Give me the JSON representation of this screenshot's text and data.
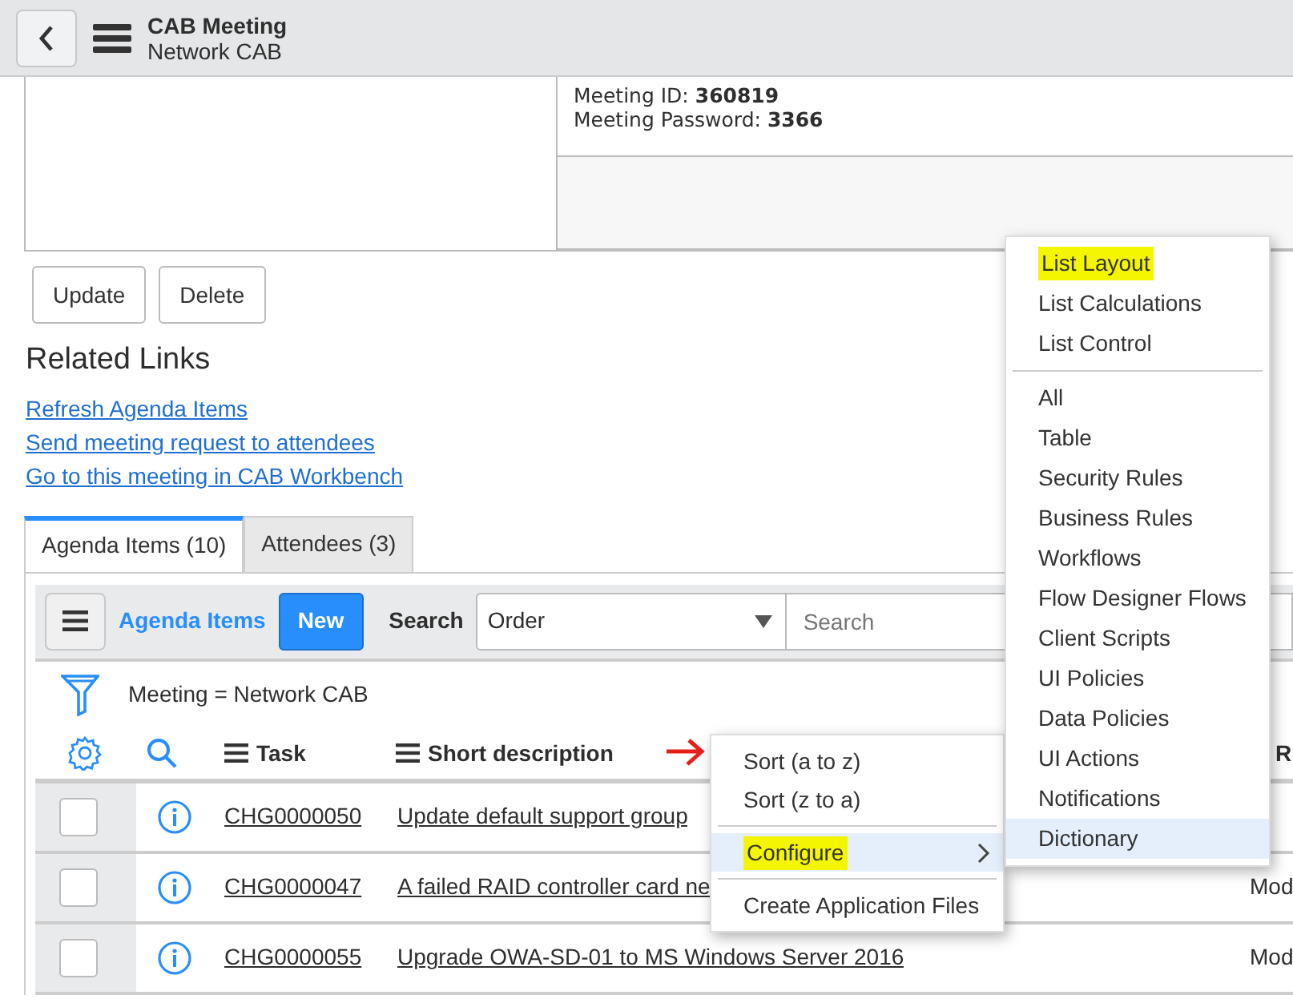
{
  "header": {
    "title": "CAB Meeting",
    "subtitle": "Network CAB"
  },
  "meeting_info": [
    "Meeting ID: **360819**",
    "Meeting Password: **3366**"
  ],
  "form_buttons": [
    "Update",
    "Delete"
  ],
  "related_links": {
    "title": "Related Links",
    "links": [
      "Refresh Agenda Items",
      "Send meeting request to attendees",
      "Go to this meeting in CAB Workbench"
    ]
  },
  "tabs": [
    {
      "label": "Agenda Items (10)",
      "selected": true
    },
    {
      "label": "Attendees (3)",
      "selected": false
    }
  ],
  "list": {
    "title": "Agenda Items",
    "new_button": "New",
    "search_label": "Search",
    "search_field": {
      "value": "Order"
    },
    "search_input": {
      "placeholder": "Search"
    },
    "filter": "Meeting = Network CAB",
    "columns": [
      "Task",
      "Short description",
      "R"
    ],
    "rows": [
      {
        "checked": false,
        "task": "CHG0000050",
        "short_description": "Update default support group"
      },
      {
        "checked": false,
        "task": "CHG0000047",
        "short_description": "A failed RAID controller card ne",
        "column_3": "Mod"
      },
      {
        "checked": false,
        "task": "CHG0000055",
        "short_description": "Upgrade OWA-SD-01 to MS Windows Server 2016",
        "column_3": "Mod"
      }
    ]
  },
  "context_menu": {
    "groups": [
      [
        {
          "label": "Sort (a to z)",
          "hovered": false,
          "highlighted": false
        },
        {
          "label": "Sort (z to a)",
          "hovered": false,
          "highlighted": false
        }
      ],
      [
        {
          "label": "Configure",
          "kind": "submenu",
          "hovered": true,
          "highlighted": true
        }
      ],
      [
        {
          "label": "Create Application Files",
          "hovered": false,
          "highlighted": false
        }
      ]
    ]
  },
  "submenu": {
    "groups": [
      [
        {
          "label": "List Layout",
          "hovered": false,
          "highlighted": true
        },
        {
          "label": "List Calculations",
          "hovered": false,
          "highlighted": false
        },
        {
          "label": "List Control",
          "hovered": false,
          "highlighted": false
        }
      ],
      [
        {
          "label": "All",
          "hovered": false,
          "highlighted": false
        },
        {
          "label": "Table",
          "hovered": false,
          "highlighted": false
        },
        {
          "label": "Security Rules",
          "hovered": false,
          "highlighted": false
        },
        {
          "label": "Business Rules",
          "hovered": false,
          "highlighted": false
        },
        {
          "label": "Workflows",
          "hovered": false,
          "highlighted": false
        },
        {
          "label": "Flow Designer Flows",
          "hovered": false,
          "highlighted": false
        },
        {
          "label": "Client Scripts",
          "hovered": false,
          "highlighted": false
        },
        {
          "label": "UI Policies",
          "hovered": false,
          "highlighted": false
        },
        {
          "label": "Data Policies",
          "hovered": false,
          "highlighted": false
        },
        {
          "label": "UI Actions",
          "hovered": false,
          "highlighted": false
        },
        {
          "label": "Notifications",
          "hovered": false,
          "highlighted": false
        },
        {
          "label": "Dictionary",
          "hovered": true,
          "highlighted": false
        }
      ]
    ]
  }
}
